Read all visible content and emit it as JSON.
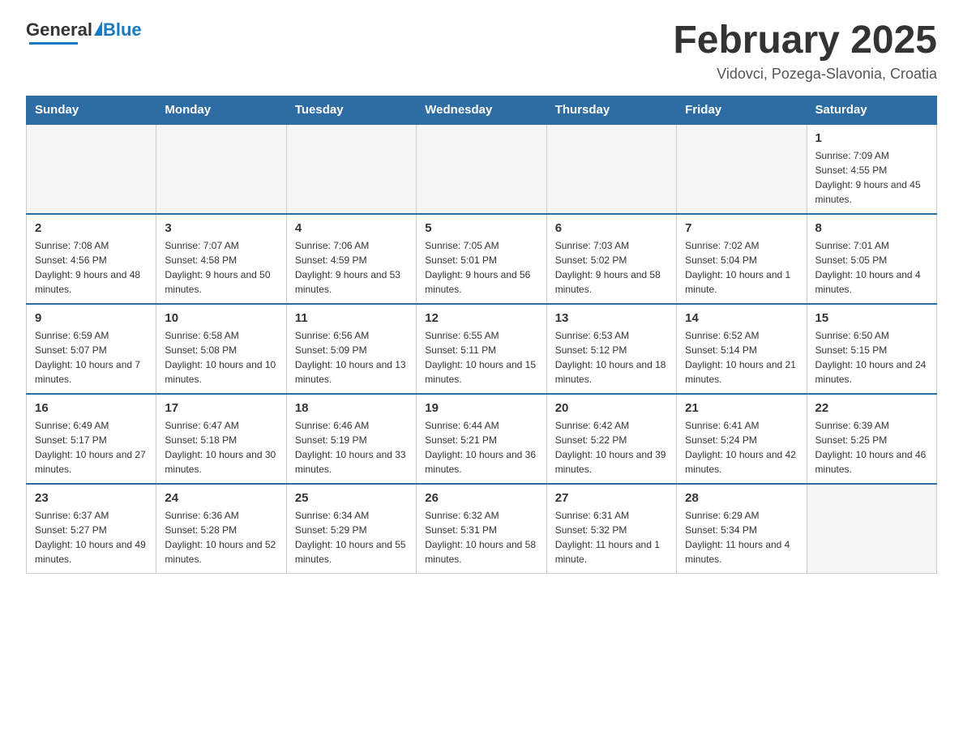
{
  "logo": {
    "general": "General",
    "triangle": "▶",
    "blue": "Blue"
  },
  "header": {
    "title": "February 2025",
    "location": "Vidovci, Pozega-Slavonia, Croatia"
  },
  "days_of_week": [
    "Sunday",
    "Monday",
    "Tuesday",
    "Wednesday",
    "Thursday",
    "Friday",
    "Saturday"
  ],
  "weeks": [
    [
      {
        "day": "",
        "info": ""
      },
      {
        "day": "",
        "info": ""
      },
      {
        "day": "",
        "info": ""
      },
      {
        "day": "",
        "info": ""
      },
      {
        "day": "",
        "info": ""
      },
      {
        "day": "",
        "info": ""
      },
      {
        "day": "1",
        "info": "Sunrise: 7:09 AM\nSunset: 4:55 PM\nDaylight: 9 hours and 45 minutes."
      }
    ],
    [
      {
        "day": "2",
        "info": "Sunrise: 7:08 AM\nSunset: 4:56 PM\nDaylight: 9 hours and 48 minutes."
      },
      {
        "day": "3",
        "info": "Sunrise: 7:07 AM\nSunset: 4:58 PM\nDaylight: 9 hours and 50 minutes."
      },
      {
        "day": "4",
        "info": "Sunrise: 7:06 AM\nSunset: 4:59 PM\nDaylight: 9 hours and 53 minutes."
      },
      {
        "day": "5",
        "info": "Sunrise: 7:05 AM\nSunset: 5:01 PM\nDaylight: 9 hours and 56 minutes."
      },
      {
        "day": "6",
        "info": "Sunrise: 7:03 AM\nSunset: 5:02 PM\nDaylight: 9 hours and 58 minutes."
      },
      {
        "day": "7",
        "info": "Sunrise: 7:02 AM\nSunset: 5:04 PM\nDaylight: 10 hours and 1 minute."
      },
      {
        "day": "8",
        "info": "Sunrise: 7:01 AM\nSunset: 5:05 PM\nDaylight: 10 hours and 4 minutes."
      }
    ],
    [
      {
        "day": "9",
        "info": "Sunrise: 6:59 AM\nSunset: 5:07 PM\nDaylight: 10 hours and 7 minutes."
      },
      {
        "day": "10",
        "info": "Sunrise: 6:58 AM\nSunset: 5:08 PM\nDaylight: 10 hours and 10 minutes."
      },
      {
        "day": "11",
        "info": "Sunrise: 6:56 AM\nSunset: 5:09 PM\nDaylight: 10 hours and 13 minutes."
      },
      {
        "day": "12",
        "info": "Sunrise: 6:55 AM\nSunset: 5:11 PM\nDaylight: 10 hours and 15 minutes."
      },
      {
        "day": "13",
        "info": "Sunrise: 6:53 AM\nSunset: 5:12 PM\nDaylight: 10 hours and 18 minutes."
      },
      {
        "day": "14",
        "info": "Sunrise: 6:52 AM\nSunset: 5:14 PM\nDaylight: 10 hours and 21 minutes."
      },
      {
        "day": "15",
        "info": "Sunrise: 6:50 AM\nSunset: 5:15 PM\nDaylight: 10 hours and 24 minutes."
      }
    ],
    [
      {
        "day": "16",
        "info": "Sunrise: 6:49 AM\nSunset: 5:17 PM\nDaylight: 10 hours and 27 minutes."
      },
      {
        "day": "17",
        "info": "Sunrise: 6:47 AM\nSunset: 5:18 PM\nDaylight: 10 hours and 30 minutes."
      },
      {
        "day": "18",
        "info": "Sunrise: 6:46 AM\nSunset: 5:19 PM\nDaylight: 10 hours and 33 minutes."
      },
      {
        "day": "19",
        "info": "Sunrise: 6:44 AM\nSunset: 5:21 PM\nDaylight: 10 hours and 36 minutes."
      },
      {
        "day": "20",
        "info": "Sunrise: 6:42 AM\nSunset: 5:22 PM\nDaylight: 10 hours and 39 minutes."
      },
      {
        "day": "21",
        "info": "Sunrise: 6:41 AM\nSunset: 5:24 PM\nDaylight: 10 hours and 42 minutes."
      },
      {
        "day": "22",
        "info": "Sunrise: 6:39 AM\nSunset: 5:25 PM\nDaylight: 10 hours and 46 minutes."
      }
    ],
    [
      {
        "day": "23",
        "info": "Sunrise: 6:37 AM\nSunset: 5:27 PM\nDaylight: 10 hours and 49 minutes."
      },
      {
        "day": "24",
        "info": "Sunrise: 6:36 AM\nSunset: 5:28 PM\nDaylight: 10 hours and 52 minutes."
      },
      {
        "day": "25",
        "info": "Sunrise: 6:34 AM\nSunset: 5:29 PM\nDaylight: 10 hours and 55 minutes."
      },
      {
        "day": "26",
        "info": "Sunrise: 6:32 AM\nSunset: 5:31 PM\nDaylight: 10 hours and 58 minutes."
      },
      {
        "day": "27",
        "info": "Sunrise: 6:31 AM\nSunset: 5:32 PM\nDaylight: 11 hours and 1 minute."
      },
      {
        "day": "28",
        "info": "Sunrise: 6:29 AM\nSunset: 5:34 PM\nDaylight: 11 hours and 4 minutes."
      },
      {
        "day": "",
        "info": ""
      }
    ]
  ]
}
